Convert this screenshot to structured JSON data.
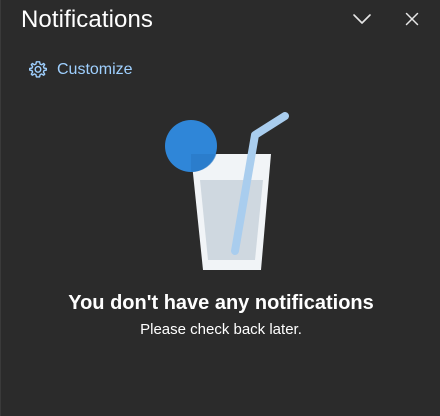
{
  "header": {
    "title": "Notifications",
    "collapse_icon": "chevron-down-icon",
    "close_icon": "close-icon"
  },
  "toolbar": {
    "customize_label": "Customize",
    "customize_icon": "gear-icon"
  },
  "empty_state": {
    "illustration": "drink-glass-illustration",
    "title": "You don't have any notifications",
    "subtitle": "Please check back later."
  },
  "colors": {
    "background": "#2b2b2b",
    "link": "#9fd0ff",
    "accent": "#2f86d8"
  }
}
